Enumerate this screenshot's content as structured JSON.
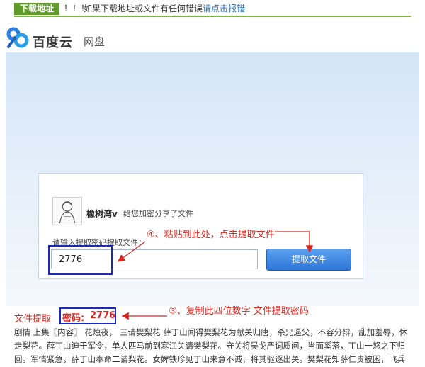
{
  "notice": {
    "tag": "下载地址",
    "bangs": "！！！",
    "message": "如果下载地址或文件有任何错误",
    "link": "请点击报错"
  },
  "header": {
    "brand": "百度云",
    "sub": "网盘",
    "logo_icon": "baidu-cloud-logo-icon"
  },
  "share": {
    "username": "橡树湾v",
    "share_text": "给您加密分享了文件",
    "password_label": "请输入提取密码提取文件：",
    "password_value": "2776",
    "extract_button": "提取文件",
    "avatar_icon": "sketch-avatar-icon"
  },
  "annotations": {
    "step4": "④、粘贴到此处，点击提取文件",
    "step3": "③、复制此四位数字 文件提取密码"
  },
  "password_line": {
    "prefix": "文件提取",
    "label": "密码:",
    "code": "2776"
  },
  "story": {
    "line1": "剧情 上集〖内容〗 花烛夜，  三请樊梨花 薛丁山闻得樊梨花为献关归唐，杀兄逼父，不容分辩，乱加羞辱，休",
    "line2": "走梨花。薛丁山迫于军令，单人匹马前到寒江关请樊梨花。守关将吴戈严词质问，当面奚落，丁山一怒之下归",
    "line3": "回。军情紧急，薛丁山奉命二请梨花。女婢铁珍见丁山来意不诚，将其驱逐出关。樊梨花知薛仁贵被困，飞兵"
  },
  "colors": {
    "notice_green": "#5f9a2a",
    "annotation_red": "#d8261f",
    "annotation_blue": "#1a29b8",
    "button_blue": "#2e76d8"
  }
}
